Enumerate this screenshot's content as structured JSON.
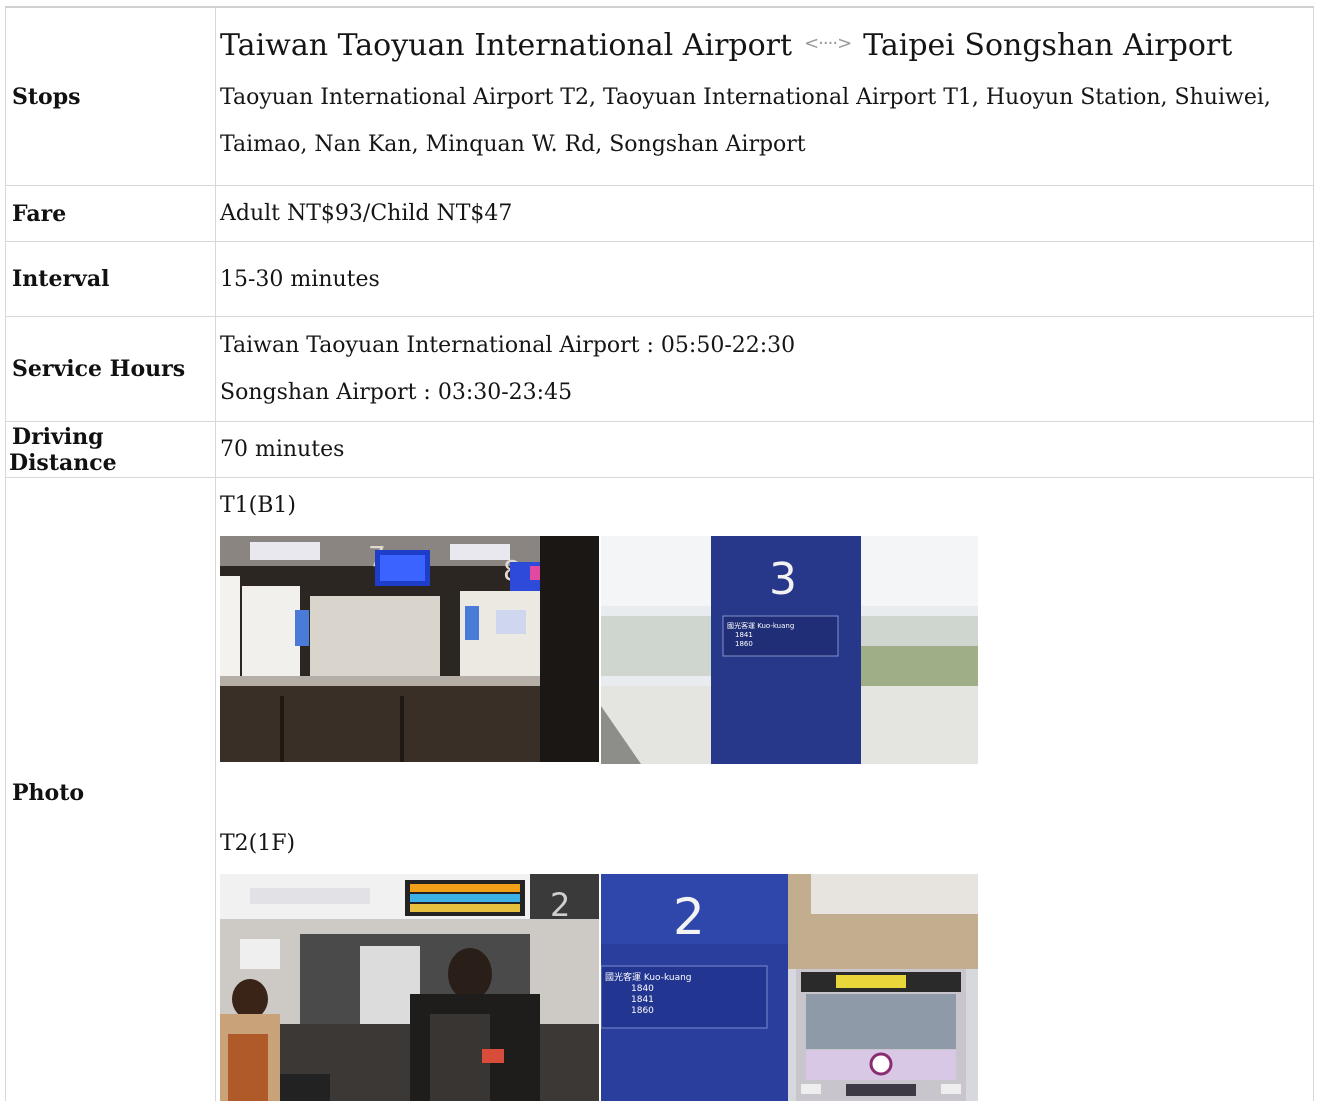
{
  "rows": {
    "stops": {
      "label": "Stops",
      "route_from": "Taiwan Taoyuan International Airport",
      "route_to": "Taipei Songshan Airport",
      "route_icon": "double-arrow-icon",
      "stops_list": "Taoyuan International Airport T2, Taoyuan International Airport T1, Huoyun Station, Shuiwei, Taimao, Nan Kan,  Minquan W. Rd, Songshan Airport"
    },
    "fare": {
      "label": "Fare",
      "value": "Adult NT$93/Child NT$47"
    },
    "interval": {
      "label": "Interval",
      "value": "15-30 minutes"
    },
    "service_hours": {
      "label": "Service Hours",
      "line1": "Taiwan Taoyuan International Airport : 05:50-22:30",
      "line2": "Songshan Airport : 03:30-23:45"
    },
    "driving_distance": {
      "label": "Driving Distance",
      "value": "70 minutes"
    },
    "photo": {
      "label": "Photo",
      "t1_caption": "T1(B1)",
      "t2_caption": "T2(1F)",
      "t1_sign_number": "3",
      "t2_sign_number": "2",
      "t2_counter_number": "2",
      "t1_sign_lines": [
        "國光客運 Kuo-kuang",
        "1841",
        "1860"
      ],
      "t2_sign_lines": [
        "國光客運 Kuo-kuang",
        "1840",
        "1841",
        "1860"
      ]
    }
  },
  "colors": {
    "border": "#d7d7d7",
    "sign_blue": "#1f3a93",
    "text": "#111111"
  }
}
